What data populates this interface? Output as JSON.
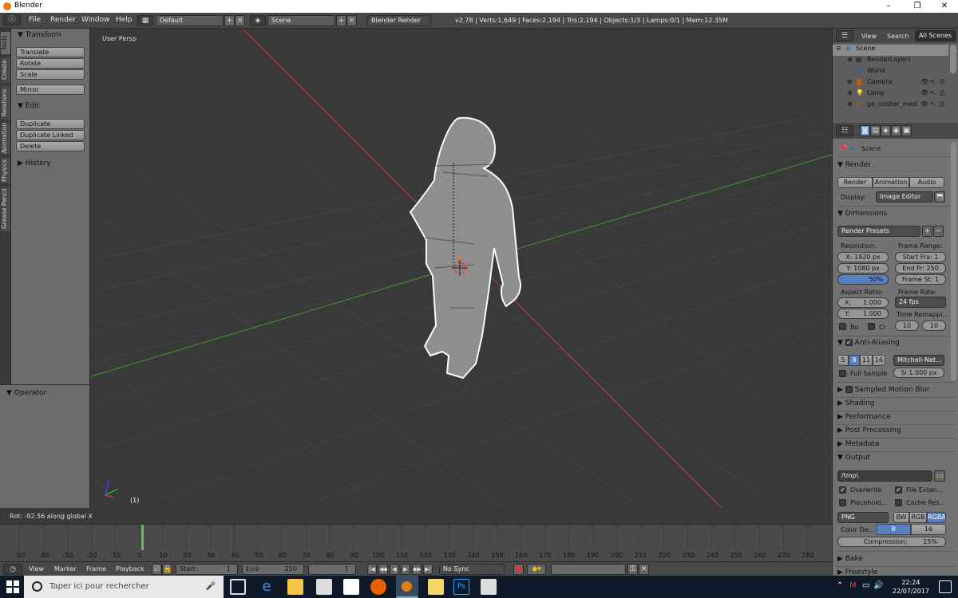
{
  "window": {
    "title": "Blender",
    "controls": [
      "–",
      "❐",
      "✕"
    ]
  },
  "menubar": {
    "items": [
      "File",
      "Render",
      "Window",
      "Help"
    ],
    "layout": "Default",
    "scene": "Scene",
    "engine": "Blender Render",
    "stats": "v2.78 | Verts:1,649 | Faces:2,194 | Tris:2,194 | Objects:1/3 | Lamps:0/1 | Mem:12.35M"
  },
  "tool_tabs": [
    "Tools",
    "Create",
    "Relations",
    "Animation",
    "Physics",
    "Grease Pencil"
  ],
  "toolshelf": {
    "transform_title": "Transform",
    "transform_buttons": [
      "Translate",
      "Rotate",
      "Scale"
    ],
    "mirror": "Mirror",
    "edit_title": "Edit",
    "edit_buttons": [
      "Duplicate",
      "Duplicate Linked",
      "Delete"
    ],
    "history_title": "History",
    "operator_title": "Operator"
  },
  "viewport": {
    "label": "User Persp",
    "frame": "(1)"
  },
  "status": {
    "text": "Rot: -92.56 along global X"
  },
  "timeline": {
    "ticks": [
      "-50",
      "-40",
      "-30",
      "-20",
      "-10",
      "0",
      "10",
      "20",
      "30",
      "40",
      "50",
      "60",
      "70",
      "80",
      "90",
      "100",
      "110",
      "120",
      "130",
      "140",
      "150",
      "160",
      "170",
      "180",
      "190",
      "200",
      "210",
      "220",
      "230",
      "240",
      "250",
      "260",
      "270",
      "280"
    ],
    "menu": [
      "View",
      "Marker",
      "Frame",
      "Playback"
    ],
    "start_label": "Start:",
    "start_value": "1",
    "end_label": "End:",
    "end_value": "250",
    "current": "1",
    "sync": "No Sync"
  },
  "outliner": {
    "menu": [
      "View",
      "Search"
    ],
    "filter": "All Scenes",
    "items": [
      "Scene",
      "RenderLayers",
      "World",
      "Camera",
      "Lamp",
      "ge_soldier_medic"
    ]
  },
  "properties": {
    "context": "Scene",
    "render_title": "Render",
    "render_buttons": [
      "Render",
      "Animation",
      "Audio"
    ],
    "display_label": "Display:",
    "display_value": "Image Editor",
    "dimensions_title": "Dimensions",
    "render_presets": "Render Presets",
    "resolution_label": "Resolution:",
    "res_x": "X: 1920 px",
    "res_y": "Y: 1080 px",
    "res_pct": "50%",
    "frame_range_label": "Frame Range:",
    "start_frame": "Start Fra: 1",
    "end_frame": "End Fr: 250",
    "frame_step": "Frame St: 1",
    "aspect_label": "Aspect Ratio:",
    "aspect_x_label": "X:",
    "aspect_x_value": "1.000",
    "aspect_y_label": "Y:",
    "aspect_y_value": "1.000",
    "frame_rate_label": "Frame Rate:",
    "frame_rate": "24 fps",
    "time_remap_label": "Time Remappi...",
    "remap_old": "10",
    "remap_new": "10",
    "border_label": "Bo",
    "crop_label": "Cr",
    "aa_title": "Anti-Aliasing",
    "aa_samples": [
      "5",
      "8",
      "11",
      "16"
    ],
    "aa_filter": "Mitchell-Net...",
    "full_sample": "Full Sample",
    "filter_size": "Si:1.000 px",
    "motion_blur": "Sampled Motion Blur",
    "collapsed_panels": [
      "Shading",
      "Performance",
      "Post Processing",
      "Metadata"
    ],
    "output_title": "Output",
    "output_path": "/tmp\\",
    "overwrite": "Overwrite",
    "file_ext": "File Exten...",
    "placeholders": "Placehold...",
    "cache_result": "Cache Res...",
    "format": "PNG",
    "color_modes": [
      "BW",
      "RGB",
      "RGBA"
    ],
    "color_depth_label": "Color De...",
    "depth_8": "8",
    "depth_16": "16",
    "compression": "Compression:",
    "compression_value": "15%",
    "bake": "Bake",
    "freestyle": "Freestyle"
  },
  "taskbar": {
    "search": "Taper ici pour rechercher",
    "time": "22:24",
    "date": "22/07/2017"
  },
  "colors": {
    "accent": "#5680c2",
    "grid_green": "#3f8b2f",
    "grid_red": "#a14242",
    "active_frame": "#64c04a"
  }
}
